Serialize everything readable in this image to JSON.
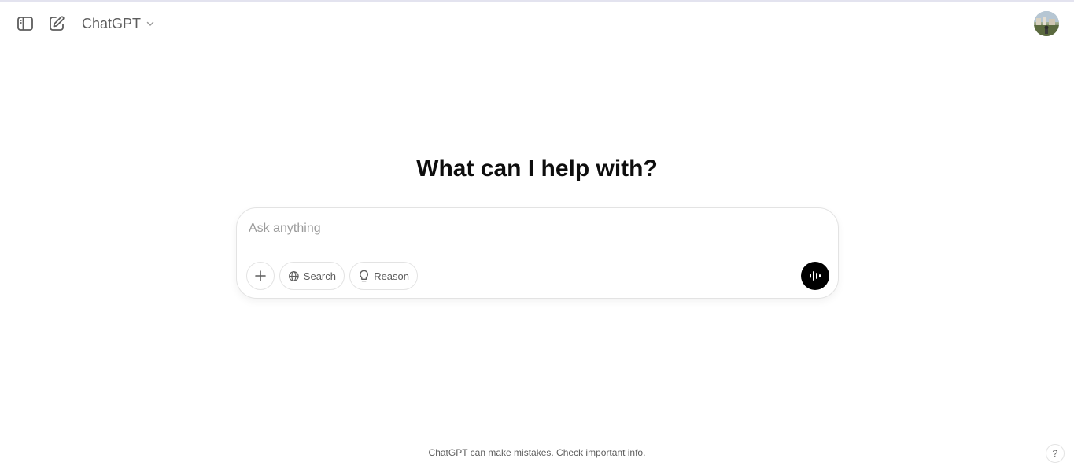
{
  "header": {
    "sidebar_toggle_icon": "sidebar-toggle-icon",
    "new_chat_icon": "new-chat-icon",
    "model_name": "ChatGPT",
    "model_chevron_icon": "chevron-down-icon",
    "avatar_icon": "user-avatar"
  },
  "main": {
    "title": "What can I help with?"
  },
  "composer": {
    "placeholder": "Ask anything",
    "value": "",
    "attach_icon": "plus-icon",
    "search_label": "Search",
    "search_icon": "globe-icon",
    "reason_label": "Reason",
    "reason_icon": "lightbulb-icon",
    "voice_icon": "voice-mode-icon"
  },
  "footer": {
    "disclaimer": "ChatGPT can make mistakes. Check important info.",
    "help_label": "?"
  },
  "colors": {
    "text_primary": "#0d0d0d",
    "text_secondary": "#5d5d5d",
    "border": "#e3e3e3",
    "voice_button_bg": "#000000"
  }
}
